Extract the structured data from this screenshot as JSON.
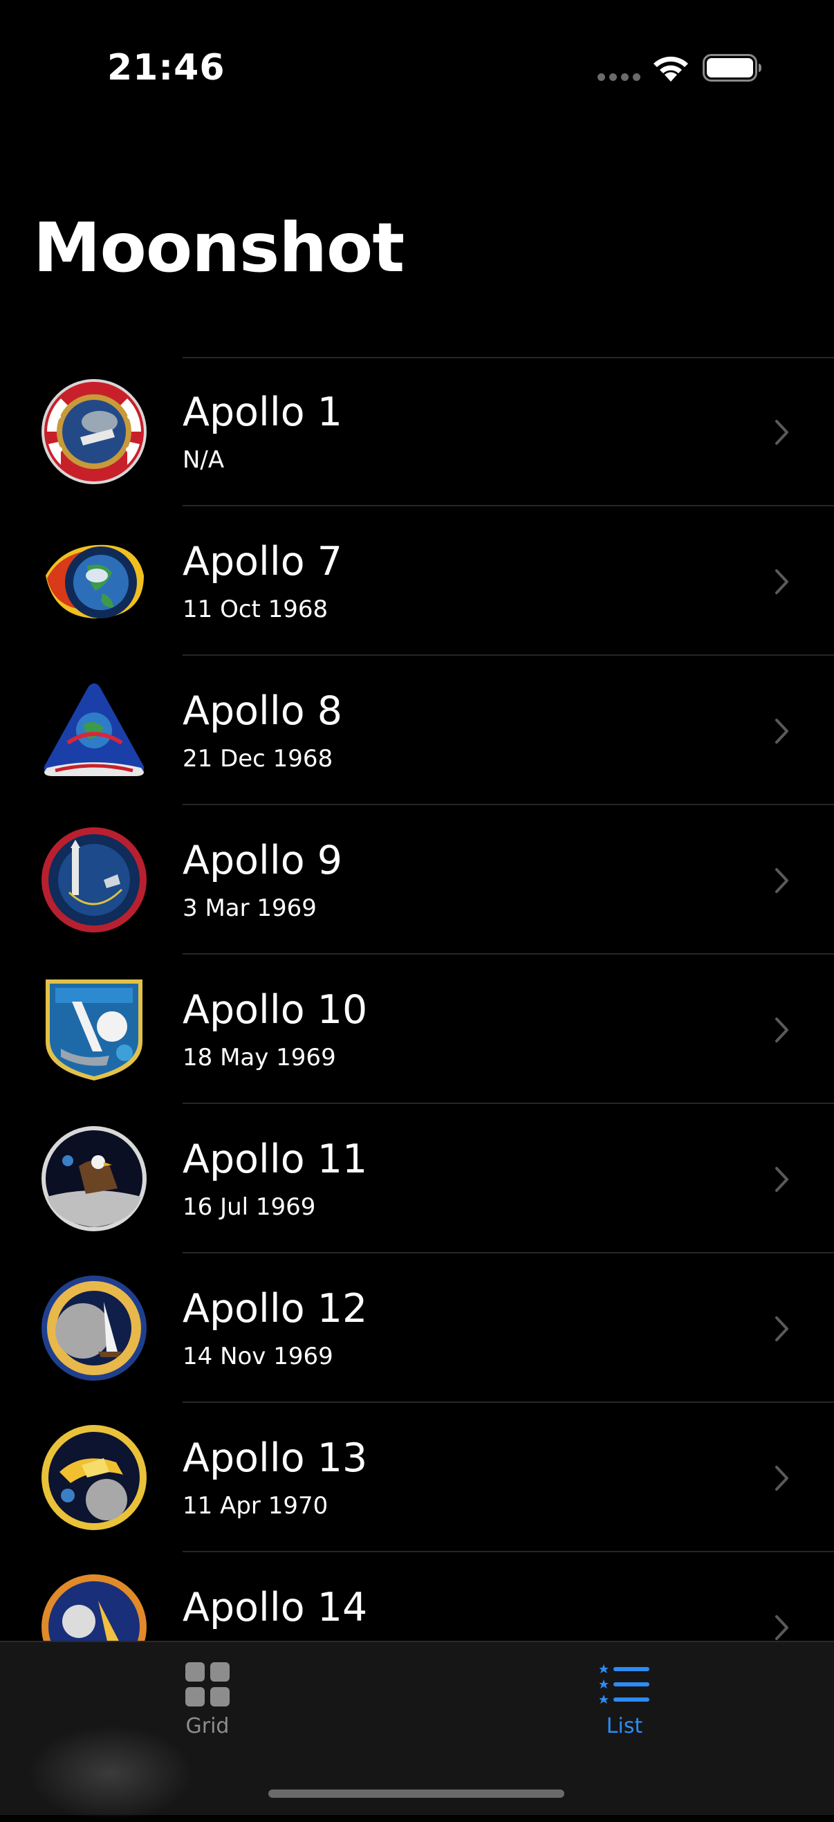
{
  "status_bar": {
    "time": "21:46"
  },
  "page": {
    "title": "Moonshot"
  },
  "missions": [
    {
      "name": "Apollo 1",
      "date": "N/A"
    },
    {
      "name": "Apollo 7",
      "date": "11 Oct 1968"
    },
    {
      "name": "Apollo 8",
      "date": "21 Dec 1968"
    },
    {
      "name": "Apollo 9",
      "date": "3 Mar 1969"
    },
    {
      "name": "Apollo 10",
      "date": "18 May 1969"
    },
    {
      "name": "Apollo 11",
      "date": "16 Jul 1969"
    },
    {
      "name": "Apollo 12",
      "date": "14 Nov 1969"
    },
    {
      "name": "Apollo 13",
      "date": "11 Apr 1970"
    },
    {
      "name": "Apollo 14",
      "date": ""
    }
  ],
  "tabs": [
    {
      "label": "Grid",
      "icon": "grid-icon",
      "selected": false
    },
    {
      "label": "List",
      "icon": "list-icon",
      "selected": true
    }
  ],
  "colors": {
    "accent": "#2c8cf4",
    "background": "#000000",
    "separator": "#262626"
  }
}
